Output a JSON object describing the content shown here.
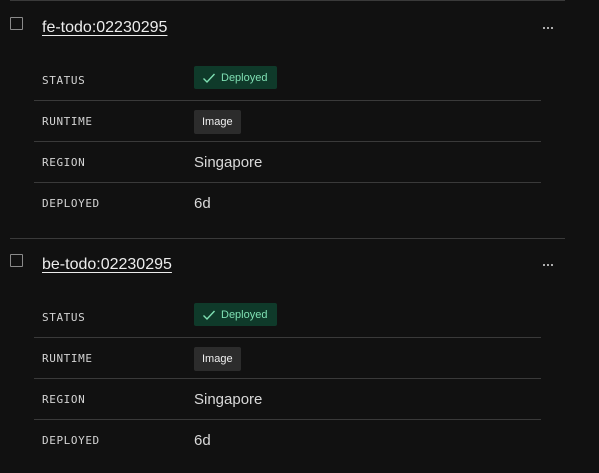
{
  "services": [
    {
      "name": "fe-todo:02230295",
      "status": "Deployed",
      "runtime": "Image",
      "region": "Singapore",
      "deployed": "6d"
    },
    {
      "name": "be-todo:02230295",
      "status": "Deployed",
      "runtime": "Image",
      "region": "Singapore",
      "deployed": "6d"
    }
  ],
  "labels": {
    "status": "STATUS",
    "runtime": "RUNTIME",
    "region": "REGION",
    "deployed": "DEPLOYED"
  },
  "icons": {
    "status_check": "check-icon",
    "more": "more-horizontal-icon",
    "select": "checkbox"
  },
  "colors": {
    "background": "#111111",
    "status_badge_bg": "#0f3a2a",
    "status_badge_text": "#7fe0b3",
    "runtime_badge_bg": "#2c2c2c",
    "divider": "#3a3a3a"
  }
}
